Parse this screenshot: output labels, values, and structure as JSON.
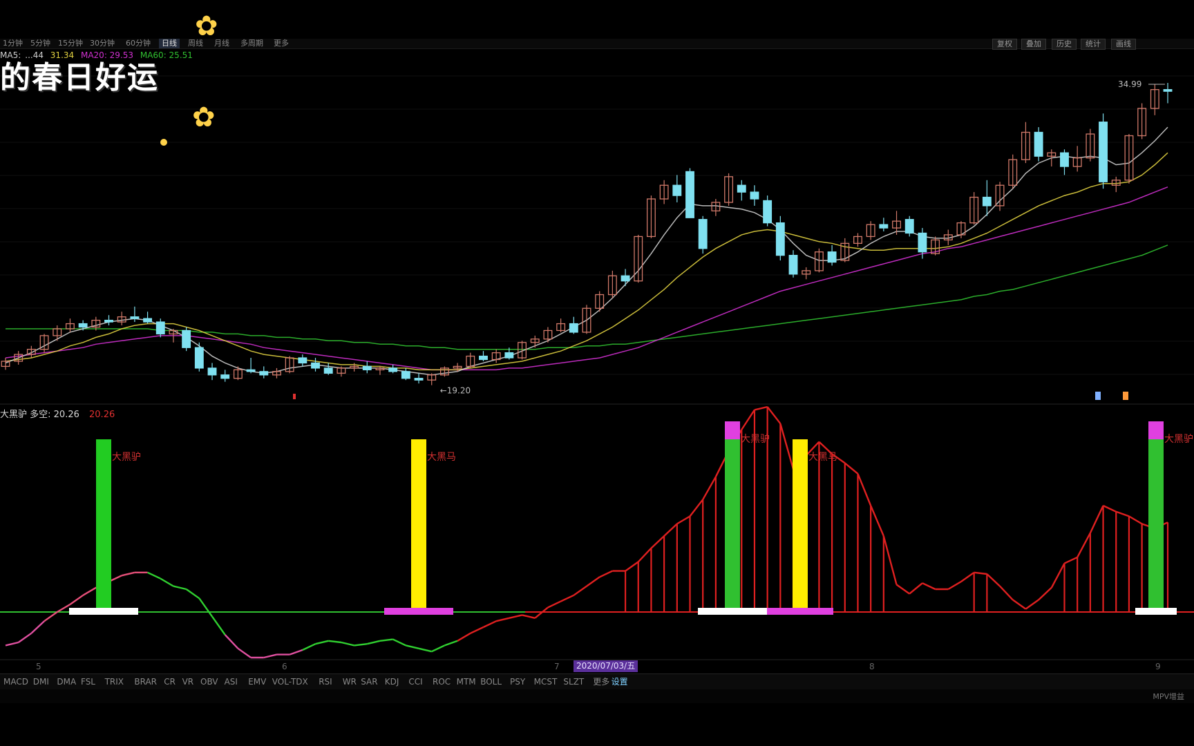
{
  "topbar": {
    "left_tabs": [
      "1分钟",
      "5分钟",
      "15分钟",
      "30分钟",
      "60分钟",
      "日线",
      "周线",
      "月线",
      "多周期",
      "更多"
    ],
    "active_tab": 5,
    "right_tabs": [
      "复权",
      "叠加",
      "历史",
      "统计",
      "画线"
    ]
  },
  "ma_line": {
    "ma5_prefix": "MA5:",
    "ma5_value": "...44",
    "ma10_value": "31.34",
    "ma20_label": "MA20: 29.53",
    "ma60_label": "MA60: 25.51",
    "colors": {
      "ma5": "#cfcfcf",
      "ma10": "#e0d040",
      "ma20": "#d030d0",
      "ma60": "#30c030"
    }
  },
  "overlay_text": "的春日好运",
  "price": {
    "high_label": "34.99",
    "low_label": "19.20"
  },
  "indicator": {
    "name": "大黑驴 多空:",
    "value": "20.26",
    "value2": "20.26",
    "signals": [
      {
        "label": "大黑驴",
        "color": "#d03030"
      },
      {
        "label": "大黑马",
        "color": "#d03030"
      },
      {
        "label": "大黑驴",
        "color": "#d03030"
      },
      {
        "label": "大黑马",
        "color": "#d03030"
      },
      {
        "label": "大黑驴",
        "color": "#d03030"
      }
    ]
  },
  "x_axis": {
    "labels": [
      "5",
      "6",
      "7",
      "8",
      "9"
    ],
    "cursor_date": "2020/07/03/五"
  },
  "bottom_tabs": [
    "MACD",
    "DMI",
    "DMA",
    "FSL",
    "TRIX",
    "BRAR",
    "CR",
    "VR",
    "OBV",
    "ASI",
    "EMV",
    "VOL-TDX",
    "RSI",
    "WR",
    "SAR",
    "KDJ",
    "CCI",
    "ROC",
    "MTM",
    "BOLL",
    "PSY",
    "MCST",
    "SLZT",
    "更多",
    "设置"
  ],
  "bottom_active": 24,
  "status": {
    "right": "MPV增益"
  },
  "candles": [
    [
      18.4,
      18.9,
      18.2,
      18.7
    ],
    [
      18.7,
      19.3,
      18.5,
      19.1
    ],
    [
      19.1,
      19.6,
      18.9,
      19.4
    ],
    [
      19.4,
      20.3,
      19.2,
      20.2
    ],
    [
      20.2,
      20.8,
      19.9,
      20.6
    ],
    [
      20.6,
      21.2,
      20.4,
      20.9
    ],
    [
      20.9,
      21.1,
      20.5,
      20.7
    ],
    [
      20.7,
      21.3,
      20.5,
      21.1
    ],
    [
      21.1,
      21.4,
      20.8,
      21.0
    ],
    [
      21.0,
      21.6,
      20.8,
      21.3
    ],
    [
      21.3,
      21.9,
      21.0,
      21.2
    ],
    [
      21.2,
      21.6,
      20.9,
      21.0
    ],
    [
      21.0,
      21.2,
      20.1,
      20.3
    ],
    [
      20.3,
      20.6,
      19.8,
      20.5
    ],
    [
      20.5,
      20.7,
      19.3,
      19.5
    ],
    [
      19.5,
      19.8,
      18.1,
      18.3
    ],
    [
      18.3,
      18.6,
      17.6,
      17.9
    ],
    [
      17.9,
      18.2,
      17.5,
      17.7
    ],
    [
      17.7,
      18.4,
      17.6,
      18.2
    ],
    [
      18.2,
      18.9,
      18.0,
      18.1
    ],
    [
      18.1,
      18.4,
      17.7,
      17.9
    ],
    [
      17.9,
      18.3,
      17.7,
      18.1
    ],
    [
      18.1,
      19.0,
      18.0,
      18.9
    ],
    [
      18.9,
      19.1,
      18.4,
      18.6
    ],
    [
      18.6,
      18.9,
      18.1,
      18.3
    ],
    [
      18.3,
      18.6,
      17.9,
      18.0
    ],
    [
      18.0,
      18.4,
      17.8,
      18.3
    ],
    [
      18.3,
      18.6,
      18.1,
      18.4
    ],
    [
      18.4,
      18.7,
      18.0,
      18.2
    ],
    [
      18.2,
      18.4,
      17.9,
      18.3
    ],
    [
      18.3,
      18.5,
      18.0,
      18.1
    ],
    [
      18.1,
      18.3,
      17.6,
      17.7
    ],
    [
      17.7,
      18.0,
      17.4,
      17.6
    ],
    [
      17.6,
      18.0,
      17.3,
      17.9
    ],
    [
      17.9,
      18.4,
      17.8,
      18.3
    ],
    [
      18.3,
      18.6,
      18.1,
      18.4
    ],
    [
      18.4,
      19.2,
      18.3,
      19.0
    ],
    [
      19.0,
      19.3,
      18.7,
      18.8
    ],
    [
      18.8,
      19.4,
      18.6,
      19.2
    ],
    [
      19.2,
      19.5,
      18.8,
      18.9
    ],
    [
      18.9,
      19.9,
      18.8,
      19.8
    ],
    [
      19.8,
      20.2,
      19.5,
      20.0
    ],
    [
      20.0,
      20.7,
      19.8,
      20.5
    ],
    [
      20.5,
      21.2,
      20.4,
      20.9
    ],
    [
      20.9,
      21.3,
      20.3,
      20.4
    ],
    [
      20.4,
      22.0,
      20.3,
      21.8
    ],
    [
      21.8,
      22.8,
      21.6,
      22.6
    ],
    [
      22.6,
      24.0,
      22.4,
      23.7
    ],
    [
      23.7,
      24.1,
      23.1,
      23.4
    ],
    [
      23.4,
      26.1,
      23.3,
      26.0
    ],
    [
      26.0,
      28.4,
      25.9,
      28.2
    ],
    [
      28.2,
      29.3,
      27.9,
      29.0
    ],
    [
      29.0,
      29.6,
      28.0,
      28.4
    ],
    [
      29.8,
      30.0,
      27.1,
      27.1
    ],
    [
      27.0,
      27.2,
      25.0,
      25.3
    ],
    [
      27.5,
      28.2,
      27.2,
      28.0
    ],
    [
      28.0,
      29.7,
      27.8,
      29.5
    ],
    [
      29.0,
      29.3,
      28.1,
      28.6
    ],
    [
      28.6,
      29.0,
      27.8,
      28.2
    ],
    [
      28.1,
      28.4,
      26.6,
      26.8
    ],
    [
      26.8,
      27.2,
      24.6,
      24.9
    ],
    [
      24.9,
      25.2,
      23.6,
      23.8
    ],
    [
      23.8,
      24.2,
      23.5,
      24.0
    ],
    [
      24.0,
      25.3,
      23.9,
      25.1
    ],
    [
      25.1,
      25.5,
      24.3,
      24.5
    ],
    [
      24.6,
      25.9,
      24.5,
      25.6
    ],
    [
      25.6,
      26.2,
      25.4,
      26.0
    ],
    [
      26.0,
      26.9,
      25.8,
      26.7
    ],
    [
      26.7,
      27.1,
      26.3,
      26.5
    ],
    [
      26.5,
      27.5,
      26.1,
      26.9
    ],
    [
      27.0,
      27.2,
      26.0,
      26.2
    ],
    [
      26.2,
      26.5,
      24.7,
      25.1
    ],
    [
      25.0,
      26.0,
      24.9,
      25.8
    ],
    [
      25.8,
      26.4,
      25.5,
      26.1
    ],
    [
      26.1,
      26.9,
      25.9,
      26.8
    ],
    [
      26.8,
      28.6,
      26.7,
      28.3
    ],
    [
      28.3,
      29.3,
      27.2,
      27.8
    ],
    [
      27.8,
      29.2,
      27.5,
      29.0
    ],
    [
      29.0,
      30.8,
      28.8,
      30.5
    ],
    [
      30.5,
      32.7,
      30.3,
      32.1
    ],
    [
      32.1,
      32.4,
      30.4,
      30.7
    ],
    [
      30.7,
      31.1,
      30.1,
      30.9
    ],
    [
      30.9,
      31.1,
      29.6,
      30.1
    ],
    [
      30.1,
      31.3,
      29.8,
      30.6
    ],
    [
      30.6,
      32.3,
      30.4,
      32.0
    ],
    [
      32.7,
      33.2,
      28.8,
      29.2
    ],
    [
      29.0,
      29.5,
      28.6,
      29.3
    ],
    [
      29.3,
      32.0,
      29.1,
      31.9
    ],
    [
      31.9,
      33.8,
      31.7,
      33.5
    ],
    [
      33.5,
      34.9,
      33.1,
      34.6
    ],
    [
      34.6,
      34.99,
      33.8,
      34.5
    ]
  ],
  "ma_series": {
    "ma5": [
      18.6,
      18.9,
      19.2,
      19.6,
      20.0,
      20.4,
      20.6,
      20.8,
      21.0,
      21.1,
      21.2,
      21.1,
      20.8,
      20.5,
      20.1,
      19.6,
      19.0,
      18.6,
      18.3,
      18.1,
      18.0,
      18.1,
      18.3,
      18.4,
      18.5,
      18.4,
      18.3,
      18.3,
      18.3,
      18.3,
      18.2,
      18.1,
      18.0,
      17.9,
      18.0,
      18.1,
      18.4,
      18.6,
      18.8,
      19.0,
      19.3,
      19.6,
      19.9,
      20.3,
      20.7,
      21.1,
      21.7,
      22.4,
      23.2,
      24.0,
      25.0,
      26.1,
      27.1,
      27.9,
      27.8,
      27.8,
      27.7,
      27.6,
      27.4,
      27.0,
      26.4,
      25.6,
      24.9,
      24.6,
      24.6,
      24.7,
      25.1,
      25.6,
      26.0,
      26.3,
      26.3,
      26.0,
      25.9,
      25.9,
      26.1,
      26.6,
      27.3,
      28.1,
      28.8,
      29.7,
      30.3,
      30.6,
      30.7,
      30.6,
      30.7,
      30.6,
      30.2,
      30.3,
      30.9,
      31.6,
      32.4
    ],
    "ma10": [
      18.7,
      18.8,
      18.9,
      19.1,
      19.3,
      19.6,
      19.8,
      20.1,
      20.3,
      20.6,
      20.8,
      20.9,
      20.9,
      20.9,
      20.7,
      20.5,
      20.2,
      19.9,
      19.6,
      19.3,
      19.1,
      19.0,
      18.9,
      18.8,
      18.7,
      18.6,
      18.5,
      18.5,
      18.4,
      18.4,
      18.3,
      18.3,
      18.2,
      18.2,
      18.2,
      18.2,
      18.3,
      18.4,
      18.5,
      18.6,
      18.7,
      18.9,
      19.1,
      19.3,
      19.6,
      19.9,
      20.3,
      20.7,
      21.2,
      21.7,
      22.3,
      22.9,
      23.6,
      24.2,
      24.8,
      25.3,
      25.7,
      26.1,
      26.3,
      26.4,
      26.3,
      26.1,
      25.9,
      25.7,
      25.6,
      25.4,
      25.3,
      25.2,
      25.2,
      25.3,
      25.3,
      25.3,
      25.3,
      25.4,
      25.6,
      25.9,
      26.2,
      26.6,
      27.0,
      27.4,
      27.8,
      28.1,
      28.4,
      28.6,
      28.9,
      29.1,
      29.1,
      29.2,
      29.6,
      30.2,
      30.9
    ],
    "ma20": [
      18.9,
      19.0,
      19.1,
      19.2,
      19.3,
      19.4,
      19.5,
      19.7,
      19.8,
      19.9,
      20.0,
      20.1,
      20.2,
      20.2,
      20.2,
      20.1,
      20.0,
      19.9,
      19.8,
      19.7,
      19.5,
      19.4,
      19.3,
      19.2,
      19.1,
      19.0,
      18.9,
      18.8,
      18.7,
      18.6,
      18.5,
      18.4,
      18.3,
      18.2,
      18.2,
      18.2,
      18.2,
      18.2,
      18.2,
      18.3,
      18.3,
      18.4,
      18.5,
      18.6,
      18.7,
      18.8,
      18.9,
      19.1,
      19.3,
      19.5,
      19.8,
      20.1,
      20.4,
      20.7,
      21.0,
      21.3,
      21.6,
      21.9,
      22.2,
      22.5,
      22.8,
      23.0,
      23.2,
      23.4,
      23.6,
      23.8,
      24.0,
      24.2,
      24.4,
      24.6,
      24.8,
      25.0,
      25.1,
      25.3,
      25.4,
      25.6,
      25.8,
      26.0,
      26.2,
      26.4,
      26.6,
      26.8,
      27.0,
      27.2,
      27.4,
      27.6,
      27.8,
      28.0,
      28.3,
      28.6,
      28.9
    ],
    "ma60": [
      20.6,
      20.6,
      20.6,
      20.6,
      20.6,
      20.6,
      20.6,
      20.6,
      20.6,
      20.6,
      20.6,
      20.6,
      20.5,
      20.5,
      20.5,
      20.4,
      20.4,
      20.3,
      20.3,
      20.2,
      20.2,
      20.1,
      20.1,
      20.0,
      20.0,
      19.9,
      19.9,
      19.8,
      19.8,
      19.7,
      19.7,
      19.6,
      19.6,
      19.5,
      19.5,
      19.4,
      19.4,
      19.4,
      19.4,
      19.4,
      19.4,
      19.4,
      19.5,
      19.5,
      19.5,
      19.6,
      19.6,
      19.7,
      19.7,
      19.8,
      19.9,
      20.0,
      20.1,
      20.2,
      20.3,
      20.4,
      20.5,
      20.6,
      20.7,
      20.8,
      20.9,
      21.0,
      21.1,
      21.2,
      21.3,
      21.4,
      21.5,
      21.6,
      21.7,
      21.8,
      21.9,
      22.0,
      22.1,
      22.2,
      22.3,
      22.5,
      22.6,
      22.8,
      22.9,
      23.1,
      23.3,
      23.5,
      23.7,
      23.9,
      24.1,
      24.3,
      24.5,
      24.7,
      24.9,
      25.2,
      25.5
    ]
  }
}
